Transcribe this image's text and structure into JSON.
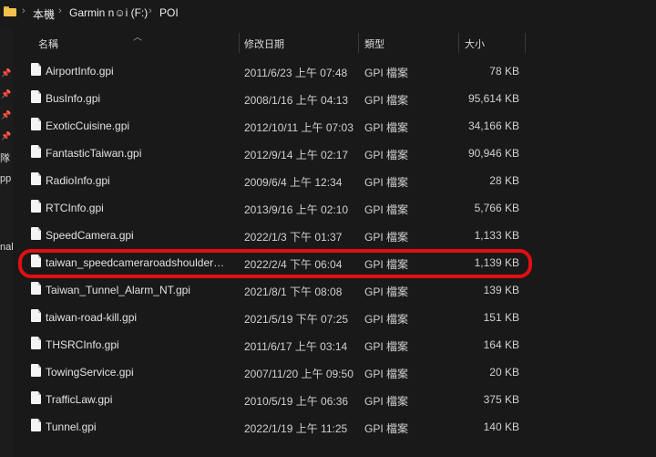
{
  "breadcrumb": {
    "items": [
      "本機",
      "Garmin n☺i (F:)",
      "POI"
    ],
    "separator": "›"
  },
  "leftpane": {
    "cut_labels": [
      "隊",
      "pp",
      "nal"
    ]
  },
  "columns": {
    "name": "名稱",
    "modified": "修改日期",
    "type": "類型",
    "size": "大小"
  },
  "files": [
    {
      "name": "AirportInfo.gpi",
      "modified": "2011/6/23 上午 07:48",
      "type": "GPI 檔案",
      "size": "78 KB"
    },
    {
      "name": "BusInfo.gpi",
      "modified": "2008/1/16 上午 04:13",
      "type": "GPI 檔案",
      "size": "95,614 KB"
    },
    {
      "name": "ExoticCuisine.gpi",
      "modified": "2012/10/11 上午 07:03",
      "type": "GPI 檔案",
      "size": "34,166 KB"
    },
    {
      "name": "FantasticTaiwan.gpi",
      "modified": "2012/9/14 上午 02:17",
      "type": "GPI 檔案",
      "size": "90,946 KB"
    },
    {
      "name": "RadioInfo.gpi",
      "modified": "2009/6/4 上午 12:34",
      "type": "GPI 檔案",
      "size": "28 KB"
    },
    {
      "name": "RTCInfo.gpi",
      "modified": "2013/9/16 上午 02:10",
      "type": "GPI 檔案",
      "size": "5,766 KB"
    },
    {
      "name": "SpeedCamera.gpi",
      "modified": "2022/1/3 下午 01:37",
      "type": "GPI 檔案",
      "size": "1,133 KB"
    },
    {
      "name": "taiwan_speedcameraroadshoulder_nt....",
      "modified": "2022/2/4 下午 06:04",
      "type": "GPI 檔案",
      "size": "1,139 KB"
    },
    {
      "name": "Taiwan_Tunnel_Alarm_NT.gpi",
      "modified": "2021/8/1 下午 08:08",
      "type": "GPI 檔案",
      "size": "139 KB"
    },
    {
      "name": "taiwan-road-kill.gpi",
      "modified": "2021/5/19 下午 07:25",
      "type": "GPI 檔案",
      "size": "151 KB"
    },
    {
      "name": "THSRCInfo.gpi",
      "modified": "2011/6/17 上午 03:14",
      "type": "GPI 檔案",
      "size": "164 KB"
    },
    {
      "name": "TowingService.gpi",
      "modified": "2007/11/20 上午 09:50",
      "type": "GPI 檔案",
      "size": "20 KB"
    },
    {
      "name": "TrafficLaw.gpi",
      "modified": "2010/5/19 上午 06:36",
      "type": "GPI 檔案",
      "size": "375 KB"
    },
    {
      "name": "Tunnel.gpi",
      "modified": "2022/1/19 上午 11:25",
      "type": "GPI 檔案",
      "size": "140 KB"
    }
  ],
  "colors": {
    "background": "#191919",
    "text": "#e2e2e2",
    "highlight_ring": "#e00f12",
    "folder": "#f2c14e"
  },
  "icons": {
    "breadcrumb_folder": "folder-icon",
    "file": "file-icon",
    "pin": "pin-icon",
    "sort": "chevron-up-icon"
  }
}
